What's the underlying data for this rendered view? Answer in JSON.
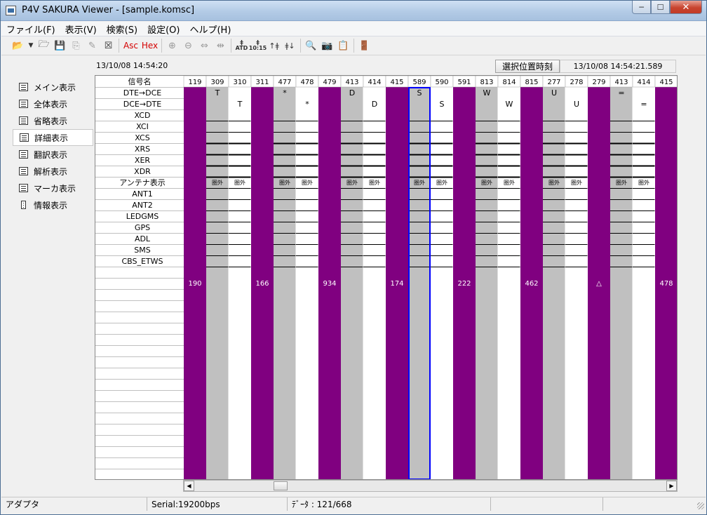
{
  "window": {
    "title": "P4V SAKURA Viewer - [sample.komsc]"
  },
  "window_controls": {
    "minimize": "─",
    "maximize": "☐",
    "close": "✕"
  },
  "menu": [
    "ファイル(F)",
    "表示(V)",
    "検索(S)",
    "設定(O)",
    "ヘルプ(H)"
  ],
  "toolbar": {
    "asc": "Asc",
    "hex": "Hex",
    "icons": [
      "open-folder-icon",
      "dropdown-arrow-icon",
      "open-file-icon",
      "save-icon",
      "copy-icon",
      "edit-icon",
      "close-file-icon",
      "asc-icon",
      "hex-icon",
      "zoom-in-icon",
      "zoom-out-icon",
      "fit-width-icon",
      "fit-all-icon",
      "find-atd-icon",
      "find-10-15-icon",
      "find-up-icon",
      "find-down-icon",
      "preview-icon",
      "camera-icon",
      "export-icon",
      "exit-icon"
    ],
    "small_labels": {
      "atd": "ATD",
      "t1015": "10:15"
    }
  },
  "sidenav": {
    "items": [
      "メイン表示",
      "全体表示",
      "省略表示",
      "詳細表示",
      "翻訳表示",
      "解析表示",
      "マーカ表示",
      "情報表示"
    ],
    "active_index": 3
  },
  "header": {
    "start_time": "13/10/08 14:54:20",
    "select_button": "選択位置時刻",
    "select_time": "13/10/08 14:54:21.589"
  },
  "grid": {
    "header_label": "信号名",
    "signals": [
      "DTE→DCE",
      "DCE→DTE",
      "XCD",
      "XCI",
      "XCS",
      "XRS",
      "XER",
      "XDR",
      "アンテナ表示",
      "ANT1",
      "ANT2",
      "LEDGMS",
      "GPS",
      "ADL",
      "SMS",
      "CBS_ETWS"
    ],
    "columns": [
      {
        "n": "119",
        "bg": "purple",
        "dte": "",
        "dce": "",
        "ant": "",
        "num": "190"
      },
      {
        "n": "309",
        "bg": "gray",
        "dte": "T",
        "dce": "",
        "ant": "圏外",
        "num": ""
      },
      {
        "n": "310",
        "bg": "white",
        "dte": "",
        "dce": "T",
        "ant": "圏外",
        "num": ""
      },
      {
        "n": "311",
        "bg": "purple",
        "dte": "",
        "dce": "",
        "ant": "",
        "num": "166"
      },
      {
        "n": "477",
        "bg": "gray",
        "dte": "*",
        "dce": "",
        "ant": "圏外",
        "num": ""
      },
      {
        "n": "478",
        "bg": "white",
        "dte": "",
        "dce": "*",
        "ant": "圏外",
        "num": ""
      },
      {
        "n": "479",
        "bg": "purple",
        "dte": "",
        "dce": "",
        "ant": "",
        "num": "934"
      },
      {
        "n": "413",
        "bg": "gray",
        "dte": "D",
        "dce": "",
        "ant": "圏外",
        "num": ""
      },
      {
        "n": "414",
        "bg": "white",
        "dte": "",
        "dce": "D",
        "ant": "圏外",
        "num": ""
      },
      {
        "n": "415",
        "bg": "purple",
        "dte": "",
        "dce": "",
        "ant": "",
        "num": "174"
      },
      {
        "n": "589",
        "bg": "gray",
        "dte": "S",
        "dce": "",
        "ant": "圏外",
        "num": "",
        "selected": true
      },
      {
        "n": "590",
        "bg": "white",
        "dte": "",
        "dce": "S",
        "ant": "圏外",
        "num": ""
      },
      {
        "n": "591",
        "bg": "purple",
        "dte": "",
        "dce": "",
        "ant": "",
        "num": "222"
      },
      {
        "n": "813",
        "bg": "gray",
        "dte": "W",
        "dce": "",
        "ant": "圏外",
        "num": ""
      },
      {
        "n": "814",
        "bg": "white",
        "dte": "",
        "dce": "W",
        "ant": "圏外",
        "num": ""
      },
      {
        "n": "815",
        "bg": "purple",
        "dte": "",
        "dce": "",
        "ant": "",
        "num": "462"
      },
      {
        "n": "277",
        "bg": "gray",
        "dte": "U",
        "dce": "",
        "ant": "圏外",
        "num": ""
      },
      {
        "n": "278",
        "bg": "white",
        "dte": "",
        "dce": "U",
        "ant": "圏外",
        "num": ""
      },
      {
        "n": "279",
        "bg": "purple",
        "dte": "",
        "dce": "",
        "ant": "",
        "num": "△"
      },
      {
        "n": "413",
        "bg": "gray",
        "dte": "=",
        "dce": "",
        "ant": "圏外",
        "num": ""
      },
      {
        "n": "414",
        "bg": "white",
        "dte": "",
        "dce": "=",
        "ant": "圏外",
        "num": ""
      },
      {
        "n": "415",
        "bg": "purple",
        "dte": "",
        "dce": "",
        "ant": "",
        "num": "478"
      }
    ],
    "colors": {
      "purple": "#800080",
      "gray": "#c0c0c0",
      "white": "#ffffff",
      "selection": "#0000ff",
      "line": "#000000"
    }
  },
  "scrollbar": {
    "left": "◀",
    "right": "▶"
  },
  "status": {
    "adapter": "アダプタ",
    "serial": "Serial:19200bps",
    "data": "ﾃﾞｰﾀ : 121/668"
  }
}
